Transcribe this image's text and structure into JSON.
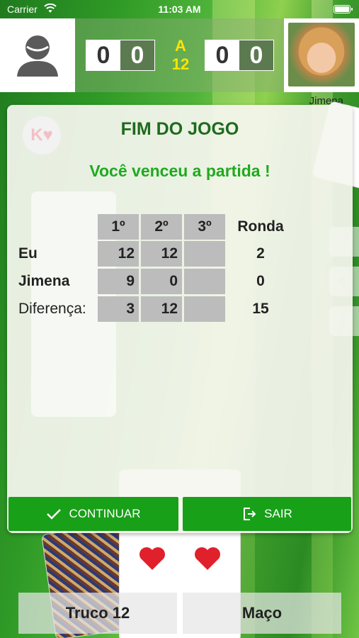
{
  "status_bar": {
    "carrier": "Carrier",
    "time": "11:03 AM"
  },
  "scoreboard": {
    "my_score": [
      "0",
      "0"
    ],
    "opponent_score": [
      "0",
      "0"
    ],
    "target_prefix": "A",
    "target_value": "12",
    "opponent_name": "Jimena"
  },
  "side_buttons": [
    "help",
    "sound",
    "back"
  ],
  "bottom_buttons": {
    "truco_label": "Truco 12",
    "maco_label": "Maço"
  },
  "dialog": {
    "logo_letter": "K",
    "title": "FIM DO JOGO",
    "subtitle": "Você venceu a partida !",
    "table": {
      "headers": [
        "1º",
        "2º",
        "3º"
      ],
      "ronda_header": "Ronda",
      "rows": [
        {
          "label": "Eu",
          "values": [
            "12",
            "12",
            ""
          ],
          "ronda": "2"
        },
        {
          "label": "Jimena",
          "values": [
            "9",
            "0",
            ""
          ],
          "ronda": "0"
        },
        {
          "label": "Diferença:",
          "values": [
            "3",
            "12",
            ""
          ],
          "ronda": "15"
        }
      ]
    },
    "continue_label": "CONTINUAR",
    "exit_label": "SAIR"
  },
  "colors": {
    "accent_green": "#18a018",
    "title_green": "#1e6a1e",
    "score_yellow": "#ffe400"
  }
}
